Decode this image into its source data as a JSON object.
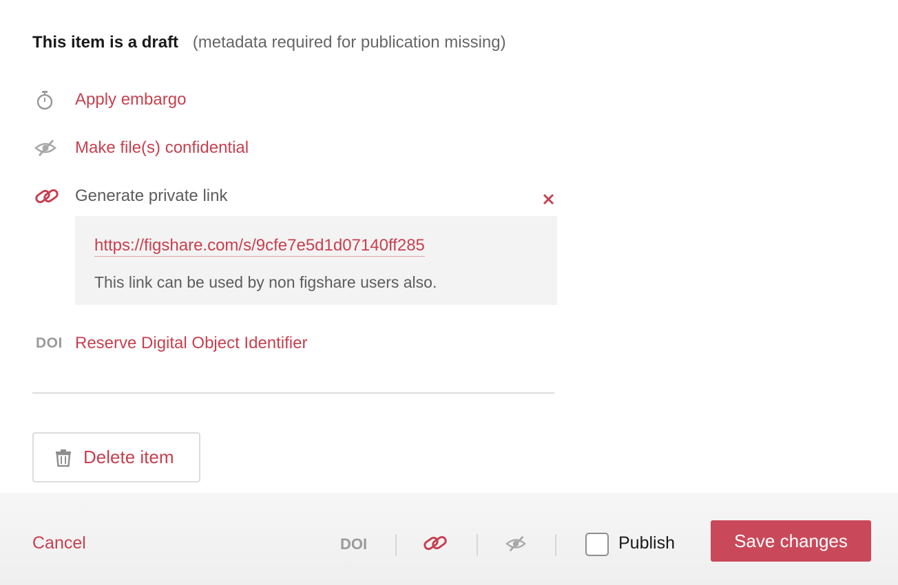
{
  "status": {
    "title": "This item is a draft",
    "note": "(metadata required for publication missing)"
  },
  "options": {
    "embargo": {
      "label": "Apply embargo",
      "icon": "stopwatch-icon"
    },
    "confidential": {
      "label": "Make file(s) confidential",
      "icon": "eye-slash-icon"
    },
    "private_link": {
      "label": "Generate private link",
      "icon": "link-icon",
      "url": "https://figshare.com/s/9cfe7e5d1d07140ff285",
      "note": "This link can be used by non figshare users also."
    },
    "doi": {
      "label": "Reserve Digital Object Identifier",
      "icon_text": "DOI"
    }
  },
  "delete": {
    "label": "Delete item",
    "icon": "trash-icon"
  },
  "footer": {
    "cancel_label": "Cancel",
    "doi_text": "DOI",
    "publish_label": "Publish",
    "publish_checked": false,
    "save_label": "Save changes"
  },
  "colors": {
    "accent": "#c7404f",
    "save_button": "#c9495a",
    "panel_bg": "#f3f3f3",
    "footer_bg": "#f3f3f3",
    "icon_gray": "#9a9a9a"
  }
}
